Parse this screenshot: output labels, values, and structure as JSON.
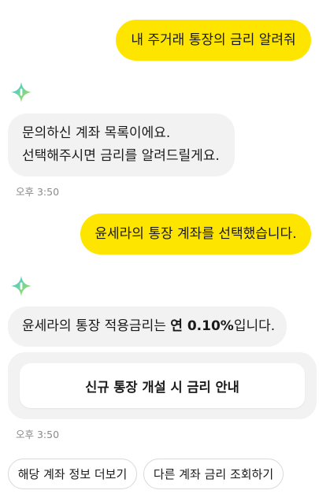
{
  "messages": {
    "user1": "내 주거래 통장의 금리 알려줘",
    "bot1_line1": "문의하신 계좌 목록이에요.",
    "bot1_line2": "선택해주시면 금리를 알려드릴게요.",
    "time1": "오후 3:50",
    "user2": "윤세라의 통장 계좌를 선택했습니다.",
    "bot2_prefix": "윤세라의 통장 적용금리는 ",
    "bot2_rate": "연 0.10%",
    "bot2_suffix": "입니다.",
    "card_button": "신규 통장 개설 시 금리 안내",
    "time2": "오후 3:50"
  },
  "quick_replies": [
    "해당 계좌 정보 더보기",
    "다른 계좌 금리 조회하기"
  ],
  "icons": {
    "bot_avatar": "sparkle-bot-icon"
  },
  "colors": {
    "user_bubble": "#FEE500",
    "bot_bubble": "#F2F2F2"
  }
}
